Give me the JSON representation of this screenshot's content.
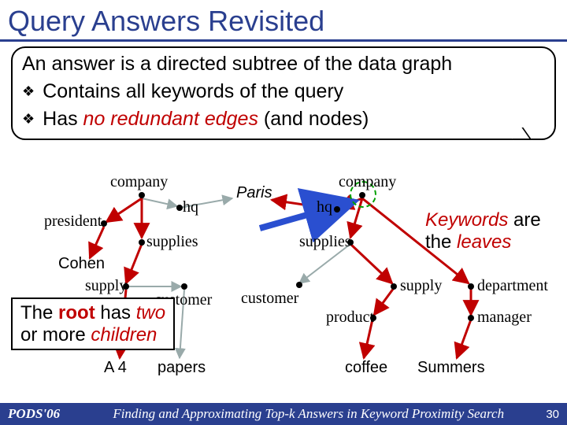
{
  "title": "Query Answers Revisited",
  "definition": "An answer is a directed subtree of the data graph",
  "bullet1": "Contains all keywords of the query",
  "bullet2_pre": "Has ",
  "bullet2_em": "no redundant edges",
  "bullet2_post": " (and nodes)",
  "labels": {
    "company_l": "company",
    "company_r": "company",
    "president": "president",
    "hq_l": "hq",
    "hq_r": "hq",
    "supplies_l": "supplies",
    "supplies_r": "supplies",
    "supply_l": "supply",
    "supply_r": "supply",
    "customer_l": "customer",
    "customer_r": "customer",
    "product": "product",
    "department": "department",
    "manager": "manager",
    "paris": "Paris",
    "cohen": "Cohen",
    "a4": "A 4",
    "papers": "papers",
    "coffee": "coffee",
    "summers": "Summers"
  },
  "root_ann_l1_pre": "The ",
  "root_ann_l1_root": "root",
  "root_ann_l1_post": " has ",
  "root_ann_l1_two": "two",
  "root_ann_l2_pre": " or more ",
  "root_ann_l2_children": "children",
  "kw_ann_l1_kw": "Keywords",
  "kw_ann_l1_post": " are",
  "kw_ann_l2_pre": "the ",
  "kw_ann_l2_leaves": "leaves",
  "footer": {
    "conf": "PODS'06",
    "title": "Finding and Approximating Top-k Answers in Keyword Proximity Search",
    "page": "30"
  }
}
